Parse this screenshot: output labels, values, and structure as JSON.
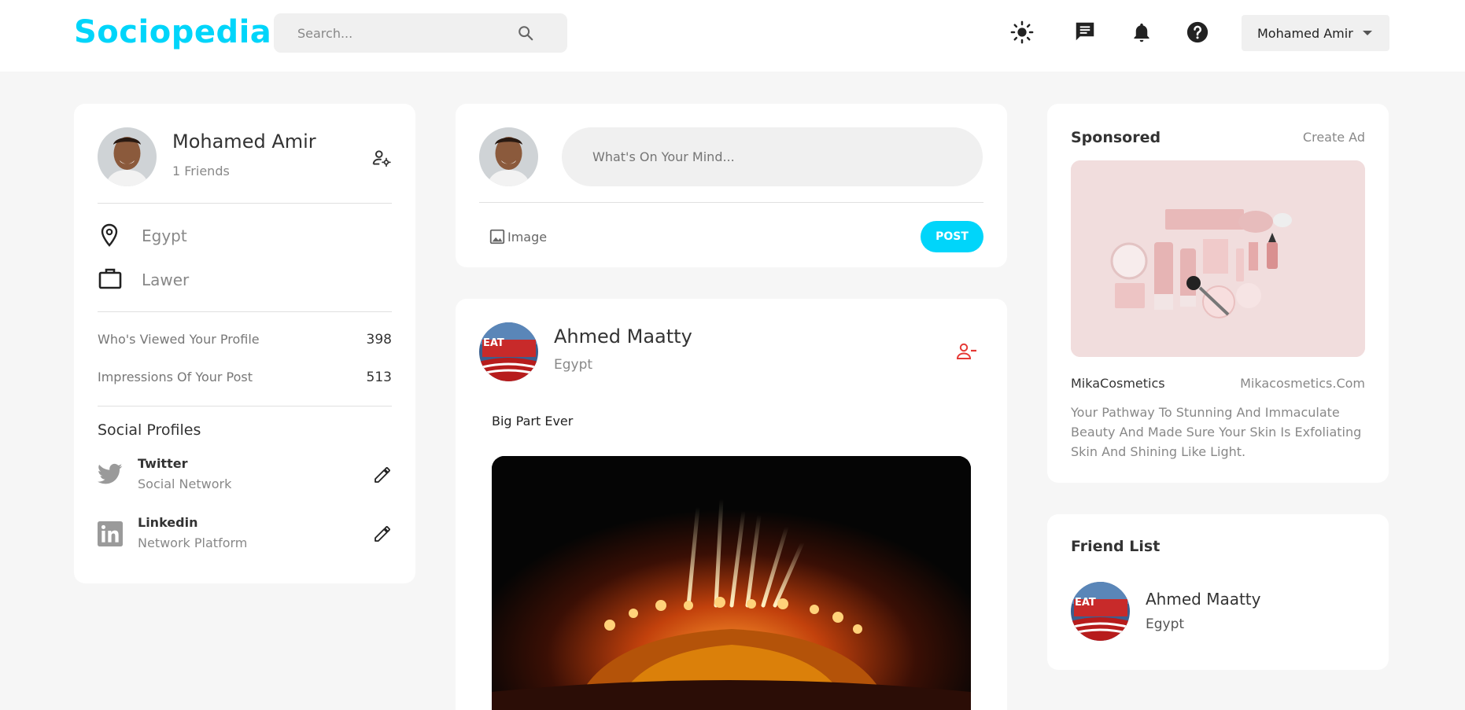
{
  "app": {
    "logo": "Sociopedia"
  },
  "navbar": {
    "search_placeholder": "Search...",
    "user_name": "Mohamed Amir"
  },
  "profile": {
    "name": "Mohamed Amir",
    "friends": "1 Friends",
    "location": "Egypt",
    "occupation": "Lawer",
    "stats": [
      {
        "label": "Who's Viewed Your Profile",
        "value": "398"
      },
      {
        "label": "Impressions Of Your Post",
        "value": "513"
      }
    ],
    "social_title": "Social Profiles",
    "socials": [
      {
        "name": "Twitter",
        "desc": "Social Network"
      },
      {
        "name": "Linkedin",
        "desc": "Network Platform"
      }
    ]
  },
  "composer": {
    "placeholder": "What's On Your Mind...",
    "image_label": "Image",
    "post_label": "POST"
  },
  "post": {
    "author": "Ahmed Maatty",
    "location": "Egypt",
    "text": "Big Part Ever",
    "avatar_sign_text": "EAT"
  },
  "sponsored": {
    "title": "Sponsored",
    "create_ad": "Create Ad",
    "brand": "MikaCosmetics",
    "site": "Mikacosmetics.Com",
    "description": "Your Pathway To Stunning And Immaculate Beauty And Made Sure Your Skin Is Exfoliating Skin And Shining Like Light."
  },
  "friends": {
    "title": "Friend List",
    "items": [
      {
        "name": "Ahmed Maatty",
        "location": "Egypt"
      }
    ]
  },
  "colors": {
    "accent": "#00d5fa",
    "danger": "#e53935",
    "bg": "#f6f6f6"
  },
  "icons": [
    "search-icon",
    "sun-icon",
    "message-icon",
    "bell-icon",
    "help-icon",
    "manage-account-icon",
    "location-icon",
    "briefcase-icon",
    "twitter-icon",
    "linkedin-icon",
    "edit-icon",
    "image-icon",
    "remove-friend-icon"
  ]
}
